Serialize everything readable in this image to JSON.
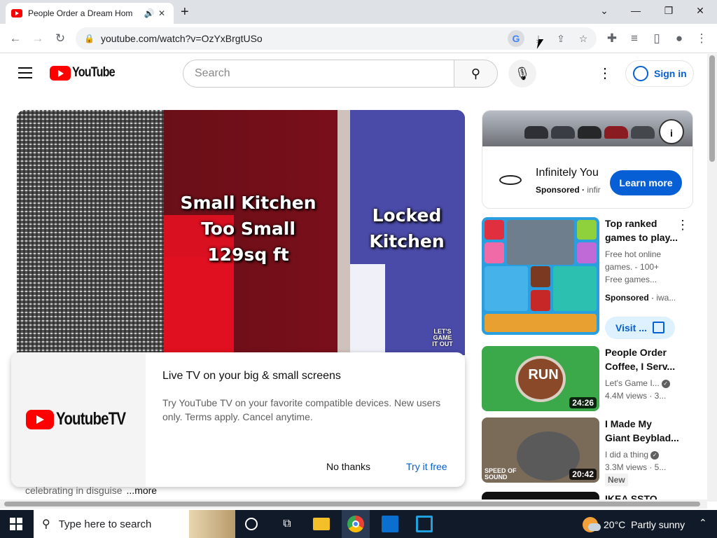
{
  "browser": {
    "tab_title": "People Order a Dream Hom",
    "tab_audio_icon": "speaker-icon",
    "tab_close": "✕",
    "new_tab": "+",
    "url": "youtube.com/watch?v=OzYxBrgtUSo"
  },
  "youtube": {
    "logo_text": "YouTube",
    "search_placeholder": "Search",
    "sign_in": "Sign in"
  },
  "player": {
    "overlay_text_left": "Small Kitchen\nToo Small\n129sq ft",
    "overlay_text_right": "Locked\nKitchen",
    "watermark": "LET'S\nGAME\nIT OUT"
  },
  "promo": {
    "logo_text": "YoutubeTV",
    "heading": "Live TV on your big & small screens",
    "body": "Try YouTube TV on your favorite compatible devices. New users only. Terms apply. Cancel anytime.",
    "dismiss": "No thanks",
    "cta": "Try it free"
  },
  "description": {
    "snippet": "celebrating in disguise",
    "more": "...more"
  },
  "ad": {
    "title": "Infinitely You",
    "sponsored": "Sponsored",
    "advertiser": "infir",
    "cta": "Learn more",
    "info": "i"
  },
  "sidebar": [
    {
      "title": "Top ranked games to play...",
      "line1": "Free hot online",
      "line2": "games. - 100+",
      "line3": "Free games...",
      "sponsored": "Sponsored",
      "advertiser": "iwa...",
      "cta": "Visit ..."
    },
    {
      "title": "People Order Coffee, I Serv...",
      "channel": "Let's Game I...",
      "meta": "4.4M views · 3...",
      "duration": "24:26",
      "thumb_text": "RUN"
    },
    {
      "title": "I Made My Giant Beyblad...",
      "channel": "I did a thing",
      "meta": "3.3M views · 5...",
      "duration": "20:42",
      "badge": "New",
      "thumb_text": "SPEED OF SOUND"
    },
    {
      "title": "IKEA SSTO"
    }
  ],
  "taskbar": {
    "search_placeholder": "Type here to search",
    "temperature": "20°C",
    "weather": "Partly sunny"
  }
}
